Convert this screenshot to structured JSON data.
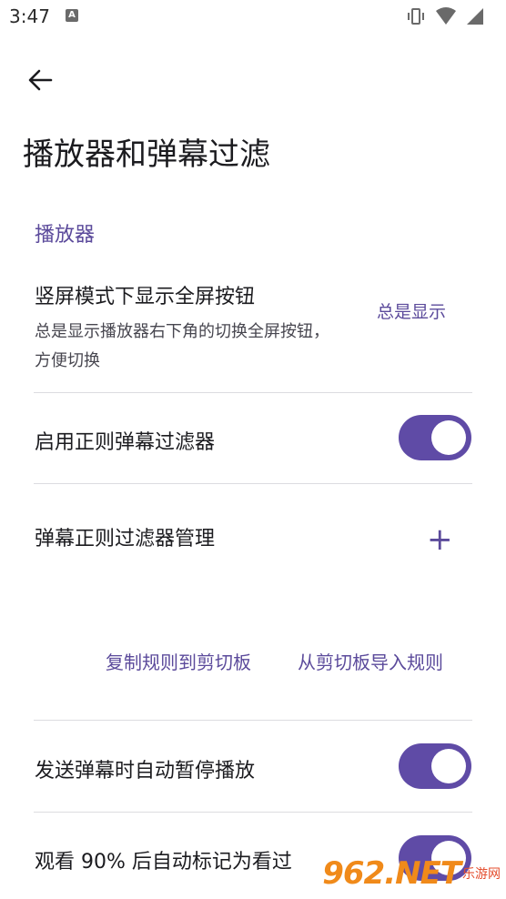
{
  "status_bar": {
    "time": "3:47",
    "notification_badge": "A"
  },
  "header": {
    "title": "播放器和弹幕过滤"
  },
  "sections": {
    "player": {
      "header": "播放器",
      "fullscreen_button": {
        "title": "竖屏模式下显示全屏按钮",
        "summary": "总是显示播放器右下角的切换全屏按钮，方便切换",
        "value": "总是显示"
      },
      "regex_filter": {
        "title": "启用正则弹幕过滤器",
        "enabled": true
      },
      "filter_manage": {
        "title": "弹幕正则过滤器管理",
        "add_symbol": "+",
        "copy_rules": "复制规则到剪切板",
        "import_rules": "从剪切板导入规则"
      },
      "auto_pause": {
        "title": "发送弹幕时自动暂停播放",
        "enabled": true
      },
      "auto_mark": {
        "title": "观看 90% 后自动标记为看过",
        "enabled": true
      }
    }
  },
  "watermark": {
    "logo": "962.NET",
    "sub": "乐游网"
  },
  "colors": {
    "accent": "#5b4a9b",
    "toggle_on": "#5f4ba6"
  }
}
